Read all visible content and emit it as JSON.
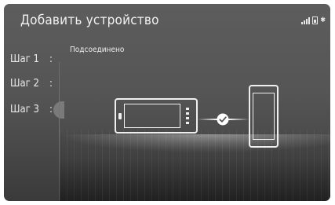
{
  "header": {
    "title": "Добавить устройство",
    "status_icons": [
      "signal-icon",
      "battery-icon",
      "bluetooth-icon"
    ]
  },
  "steps": [
    {
      "label": "Шаг 1",
      "colon": ":"
    },
    {
      "label": "Шаг 2",
      "colon": ":"
    },
    {
      "label": "Шаг 3",
      "colon": ":"
    }
  ],
  "main": {
    "status_text": "Подсоединено",
    "icons": [
      "head-unit-icon",
      "check-icon",
      "smartphone-icon"
    ]
  }
}
